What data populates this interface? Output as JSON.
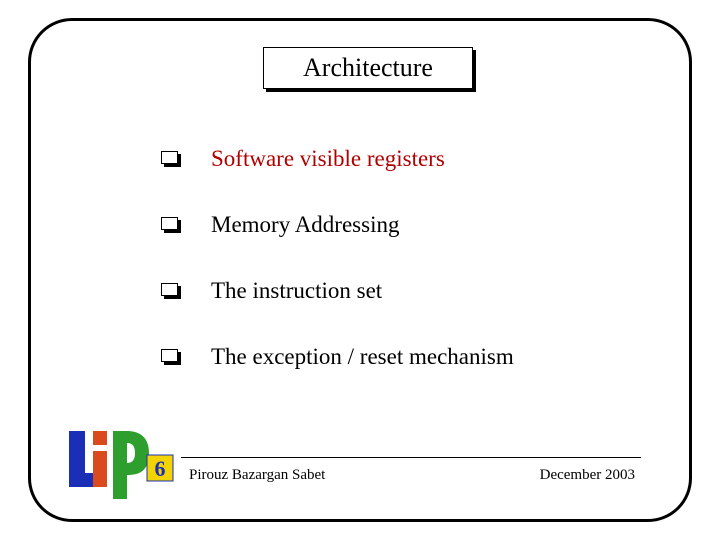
{
  "title": "Architecture",
  "bullets": [
    {
      "text": "Software visible registers",
      "highlight": true
    },
    {
      "text": "Memory Addressing",
      "highlight": false
    },
    {
      "text": "The instruction set",
      "highlight": false
    },
    {
      "text": "The exception / reset mechanism",
      "highlight": false
    }
  ],
  "footer": {
    "author": "Pirouz Bazargan Sabet",
    "date": "December 2003"
  },
  "logo": {
    "name": "LIP6",
    "digit": "6",
    "colors": {
      "l": "#1a2fb5",
      "i": "#d94b1f",
      "p": "#2e9e2e",
      "six_bg": "#f4d400",
      "six_fg": "#1a2fb5"
    }
  }
}
